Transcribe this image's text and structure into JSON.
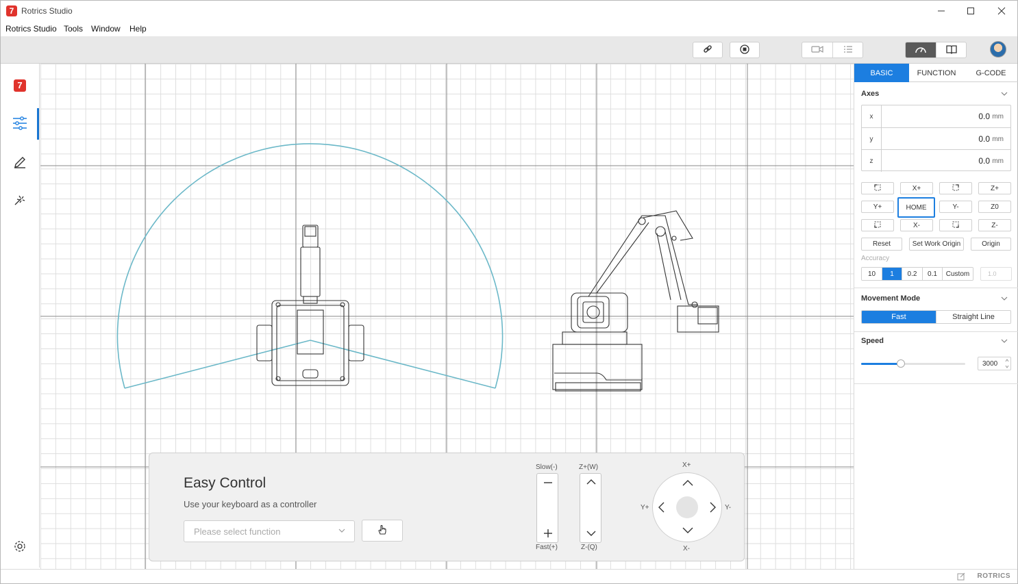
{
  "window": {
    "title": "Rotrics Studio",
    "logo_glyph": "7"
  },
  "menu": [
    "Rotrics Studio",
    "Tools",
    "Window",
    "Help"
  ],
  "toolbar": {
    "icons": [
      "link-icon",
      "stop-icon",
      "camera-icon",
      "list-icon",
      "control-dashboard-icon",
      "book-icon"
    ]
  },
  "sidebar": {
    "items": [
      "rotrics-logo",
      "control-sliders-icon",
      "pen-edit-icon",
      "laser-icon"
    ],
    "active": 1,
    "bottom": "settings-gear-icon"
  },
  "colors": {
    "accent": "#1c7ee0",
    "workspace_arc": "#6bb8c8",
    "brand_red": "#e0332c"
  },
  "easy_control": {
    "title": "Easy Control",
    "subtitle": "Use your keyboard as a controller",
    "select_placeholder": "Please select function",
    "speed_top": "Slow(-)",
    "speed_bottom": "Fast(+)",
    "z_top": "Z+(W)",
    "z_bottom": "Z-(Q)",
    "dpad": {
      "up": "X+",
      "down": "X-",
      "left": "Y+",
      "right": "Y-"
    }
  },
  "right_panel": {
    "tabs": [
      "BASIC",
      "FUNCTION",
      "G-CODE"
    ],
    "active_tab": 0,
    "axes": {
      "title": "Axes",
      "rows": [
        {
          "name": "x",
          "value": "0.0",
          "unit": "mm"
        },
        {
          "name": "y",
          "value": "0.0",
          "unit": "mm"
        },
        {
          "name": "z",
          "value": "0.0",
          "unit": "mm"
        }
      ]
    },
    "jog": {
      "x_plus": "X+",
      "z_plus": "Z+",
      "y_plus": "Y+",
      "home": "HOME",
      "y_minus": "Y-",
      "z_zero": "Z0",
      "x_minus": "X-",
      "z_minus": "Z-"
    },
    "actions": {
      "reset": "Reset",
      "set_work_origin": "Set Work Origin",
      "origin": "Origin"
    },
    "accuracy": {
      "label": "Accuracy",
      "options": [
        "10",
        "1",
        "0.2",
        "0.1",
        "Custom"
      ],
      "selected": 1,
      "custom_value": "1.0"
    },
    "movement_mode": {
      "title": "Movement Mode",
      "options": [
        "Fast",
        "Straight Line"
      ],
      "selected": 0
    },
    "speed": {
      "title": "Speed",
      "value": "3000",
      "level": 0.38
    }
  },
  "status": {
    "brand": "ROTRICS"
  }
}
